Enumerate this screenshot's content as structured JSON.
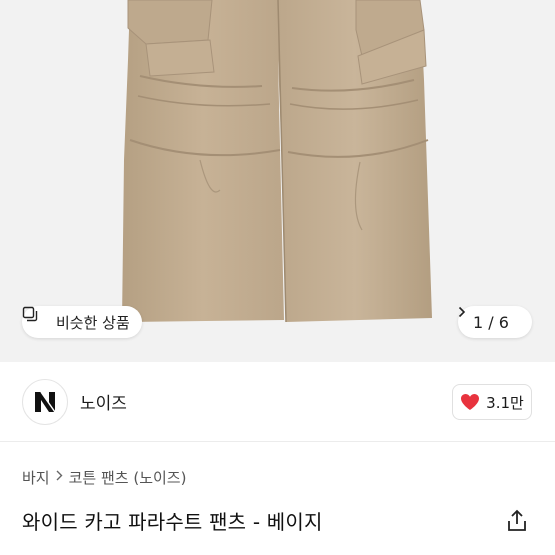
{
  "hero": {
    "similar_label": "비슷한 상품",
    "counter": "1 / 6"
  },
  "shop": {
    "name": "노이즈",
    "likes": "3.1만"
  },
  "breadcrumb": {
    "items": [
      "바지",
      "코튼 팬츠 (노이즈)"
    ]
  },
  "product": {
    "title": "와이드 카고 파라수트 팬츠 - 베이지"
  },
  "colors": {
    "product_fabric": "#c2ad90",
    "heart": "#e8333e",
    "hero_bg": "#f2f2f2"
  }
}
